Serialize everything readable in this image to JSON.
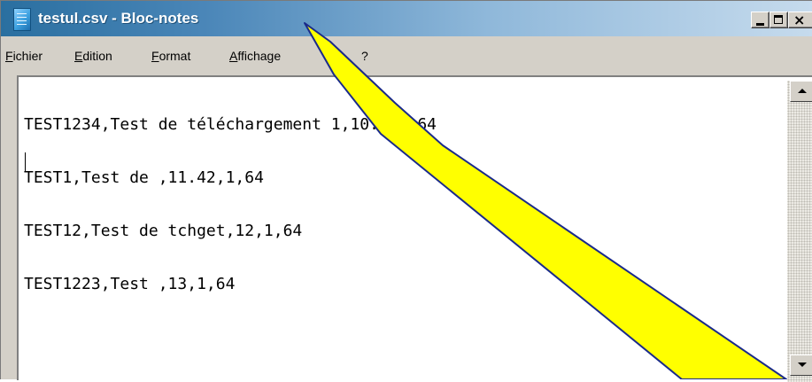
{
  "window": {
    "title": "testul.csv - Bloc-notes",
    "icon": "notepad-icon",
    "controls": {
      "minimize": "minimize-icon",
      "maximize": "maximize-icon",
      "close": "close-icon",
      "close_glyph": "×"
    }
  },
  "menu": {
    "items": [
      {
        "label": "Fichier"
      },
      {
        "label": "Edition"
      },
      {
        "label": "Format"
      },
      {
        "label": "Affichage"
      },
      {
        "label": "?"
      }
    ]
  },
  "editor": {
    "lines": [
      "TEST1234,Test de téléchargement 1,10.5,1,64",
      "TEST1,Test de ,11.42,1,64",
      "TEST12,Test de tchget,12,1,64",
      "TEST1223,Test ,13,1,64"
    ]
  },
  "colors": {
    "title_bar_start": "#2a6fa0",
    "title_bar_end": "#c6dbed",
    "chrome": "#d4d0c8",
    "arrow_fill": "#ffff00",
    "arrow_stroke": "#1a2a8a"
  }
}
